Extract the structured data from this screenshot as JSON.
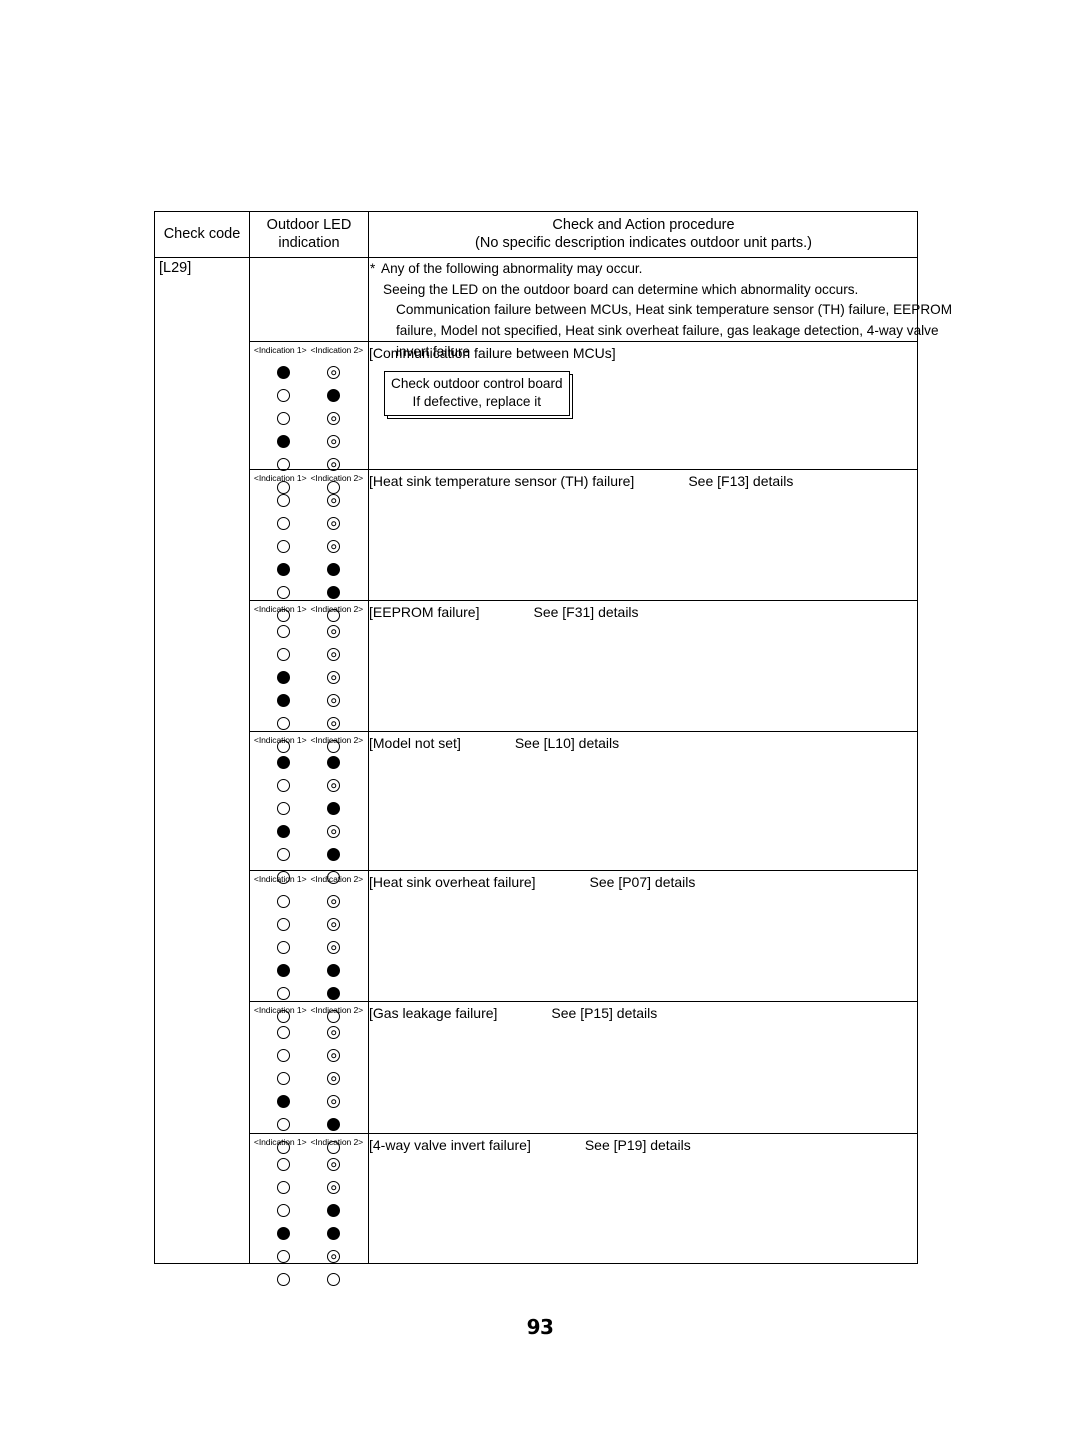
{
  "page": {
    "number": "93"
  },
  "table": {
    "headers": {
      "check_code": "Check code",
      "outdoor_led_line1": "Outdoor LED",
      "outdoor_led_line2": "indication",
      "procedure_line1": "Check and Action procedure",
      "procedure_line2": "(No specific description indicates outdoor unit parts.)"
    },
    "check_code": "[L29]",
    "intro": {
      "star": "*",
      "line1": "Any of the following abnormality may occur.",
      "line2": "Seeing the LED on the outdoor board can determine which abnormality occurs.",
      "line3": "Communication failure between MCUs, Heat sink temperature sensor (TH) failure, EEPROM",
      "line4": "failure, Model not specified, Heat sink overheat failure, gas leakage detection, 4-way valve",
      "line5": "invert failure"
    },
    "indication_header": {
      "first": "<Indication 1>",
      "second": "<Indication 2>"
    },
    "sections": [
      {
        "id": "communication-failure-between-mcus",
        "title": "[Communication failure between MCUs]",
        "see": "",
        "leds": [
          [
            "on",
            "blink"
          ],
          [
            "off",
            "on"
          ],
          [
            "off",
            "blink"
          ],
          [
            "on",
            "blink"
          ],
          [
            "off",
            "blink"
          ],
          [
            "off",
            "off"
          ]
        ],
        "action_box": {
          "line1": "Check outdoor control  board",
          "line2": "If defective, replace it"
        }
      },
      {
        "id": "heat-sink-temperature-sensor-th-failure",
        "title": "[Heat sink temperature sensor (TH) failure]",
        "see": "See [F13] details",
        "leds": [
          [
            "off",
            "blink"
          ],
          [
            "off",
            "blink"
          ],
          [
            "off",
            "blink"
          ],
          [
            "on",
            "on"
          ],
          [
            "off",
            "on"
          ],
          [
            "off",
            "off"
          ]
        ],
        "action_box": null
      },
      {
        "id": "eeprom-failure",
        "title": "[EEPROM failure]",
        "see": "See [F31] details",
        "leds": [
          [
            "off",
            "blink"
          ],
          [
            "off",
            "blink"
          ],
          [
            "on",
            "blink"
          ],
          [
            "on",
            "blink"
          ],
          [
            "off",
            "blink"
          ],
          [
            "off",
            "off"
          ]
        ],
        "action_box": null
      },
      {
        "id": "model-not-set",
        "title": "[Model not set]",
        "see": "See [L10] details",
        "leds": [
          [
            "on",
            "on"
          ],
          [
            "off",
            "blink"
          ],
          [
            "off",
            "on"
          ],
          [
            "on",
            "blink"
          ],
          [
            "off",
            "on"
          ],
          [
            "off",
            "off"
          ]
        ],
        "action_box": null
      },
      {
        "id": "heat-sink-overheat-failure",
        "title": "[Heat sink overheat failure]",
        "see": "See [P07] details",
        "leds": [
          [
            "off",
            "blink"
          ],
          [
            "off",
            "blink"
          ],
          [
            "off",
            "blink"
          ],
          [
            "on",
            "on"
          ],
          [
            "off",
            "on"
          ],
          [
            "off",
            "off"
          ]
        ],
        "action_box": null
      },
      {
        "id": "gas-leakage-failure",
        "title": "[Gas leakage failure]",
        "see": "See [P15] details",
        "leds": [
          [
            "off",
            "blink"
          ],
          [
            "off",
            "blink"
          ],
          [
            "off",
            "blink"
          ],
          [
            "on",
            "blink"
          ],
          [
            "off",
            "on"
          ],
          [
            "off",
            "off"
          ]
        ],
        "action_box": null
      },
      {
        "id": "four-way-valve-invert-failure",
        "title": "[4-way valve invert failure]",
        "see": "See [P19] details",
        "leds": [
          [
            "off",
            "blink"
          ],
          [
            "off",
            "blink"
          ],
          [
            "off",
            "on"
          ],
          [
            "on",
            "on"
          ],
          [
            "off",
            "blink"
          ],
          [
            "off",
            "off"
          ]
        ],
        "action_box": null
      }
    ]
  }
}
